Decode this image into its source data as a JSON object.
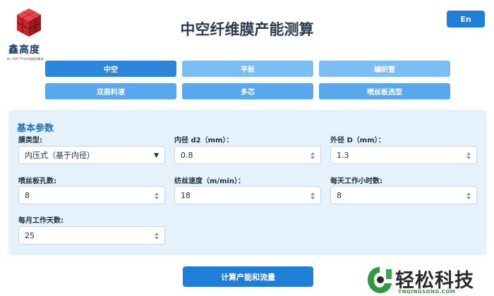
{
  "brand": {
    "name": "鑫高度",
    "tagline": "新一代PCT中空纤维膜测算者",
    "accent": "#d9262c"
  },
  "page": {
    "title": "中空纤维膜产能测算"
  },
  "language_button": "En",
  "tabs": [
    {
      "label": "中空",
      "active": true
    },
    {
      "label": "平板",
      "active": false
    },
    {
      "label": "编织管",
      "active": false
    },
    {
      "label": "双层料液",
      "active": false
    },
    {
      "label": "多芯",
      "active": false
    },
    {
      "label": "喷丝板选型",
      "active": false
    }
  ],
  "params": {
    "title": "基本参数",
    "membrane_type": {
      "label": "膜类型:",
      "value": "内压式（基于内径）"
    },
    "inner_diameter": {
      "label": "内径 d2（mm）：",
      "value": "0.8"
    },
    "outer_diameter": {
      "label": "外径 D（mm）：",
      "value": "1.3"
    },
    "spinneret_holes": {
      "label": "喷丝板孔数:",
      "value": "8"
    },
    "spinning_speed": {
      "label": "纺丝速度（m/min）：",
      "value": "18"
    },
    "hours_per_day": {
      "label": "每天工作小时数:",
      "value": "8"
    },
    "days_per_month": {
      "label": "每月工作天数:",
      "value": "25"
    }
  },
  "submit_label": "计算产能和流量",
  "watermark": {
    "name": "轻松科技",
    "url": "YNQINGSONG.COM"
  },
  "colors": {
    "primary": "#1f7fd8",
    "tab_inactive": "#7cbdf2",
    "panel_bg": "#e6f2fb"
  }
}
